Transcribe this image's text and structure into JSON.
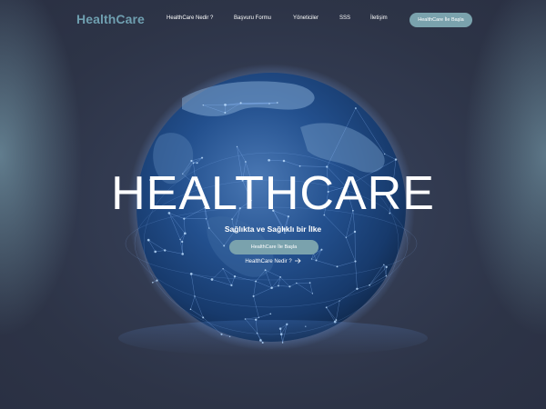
{
  "nav": {
    "logo": "HealthCare",
    "links": [
      {
        "label": "HealthCare Nedir ?"
      },
      {
        "label": "Başvuru Formu"
      },
      {
        "label": "Yöneticiler"
      },
      {
        "label": "SSS"
      },
      {
        "label": "İletişim"
      }
    ],
    "cta_label": "HealthCare İle Başla"
  },
  "hero": {
    "title": "HEALTHCARE",
    "subtitle": "Sağlıkta ve Sağlıklı bir İlke",
    "cta_label": "HealthCare İle Başla",
    "secondary_link": "HealthCare Nedir ?",
    "secondary_icon": "arrow-right-icon"
  },
  "colors": {
    "logo": "#6f9fb0",
    "accent_button": "#7aa2ad",
    "background": "#2c3346",
    "globe": "#1e4a86",
    "network": "#6fa8ff"
  }
}
